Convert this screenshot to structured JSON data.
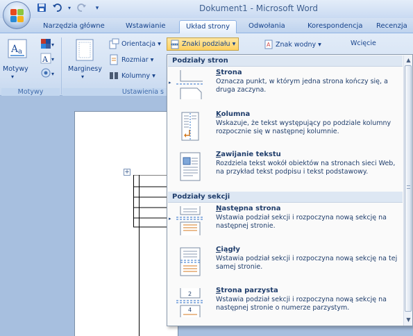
{
  "window": {
    "title": "Dokument1 - Microsoft Word"
  },
  "quick_access": {
    "icons": [
      "save-icon",
      "undo-icon",
      "redo-icon",
      "customize-icon"
    ]
  },
  "tabs": [
    {
      "label": "Narzędzia główne"
    },
    {
      "label": "Wstawianie"
    },
    {
      "label": "Układ strony",
      "active": true
    },
    {
      "label": "Odwołania"
    },
    {
      "label": "Korespondencja"
    },
    {
      "label": "Recenzja"
    }
  ],
  "ribbon": {
    "groups": {
      "themes": "Motywy",
      "page_setup": "Ustawienia s"
    },
    "themes_button": "Motywy",
    "margins_button": "Marginesy",
    "orientation": "Orientacja",
    "size": "Rozmiar",
    "columns": "Kolumny",
    "breaks": "Znaki podziału",
    "watermark": "Znak wodny",
    "indent": "Wcięcie"
  },
  "menu": {
    "section1": "Podziały stron",
    "section2": "Podziały sekcji",
    "items": [
      {
        "title_u": "S",
        "title_rest": "trona",
        "desc": "Oznacza punkt, w którym jedna strona kończy się, a druga zaczyna."
      },
      {
        "title_u": "K",
        "title_rest": "olumna",
        "desc": "Wskazuje, że tekst występujący po podziale kolumny rozpocznie się w następnej kolumnie."
      },
      {
        "title_u": "Z",
        "title_rest": "awijanie tekstu",
        "desc": "Rozdziela tekst wokół obiektów na stronach sieci Web, na przykład tekst podpisu i tekst podstawowy."
      },
      {
        "title_u": "N",
        "title_rest": "astępna strona",
        "desc": "Wstawia podział sekcji i rozpoczyna nową sekcję na następnej stronie."
      },
      {
        "title_u": "C",
        "title_rest": "iągły",
        "desc": "Wstawia podział sekcji i rozpoczyna nową sekcję na tej samej stronie."
      },
      {
        "title_u": "S",
        "title_rest": "trona parzysta",
        "desc": "Wstawia podział sekcji i rozpoczyna nową sekcję na następnej stronie o numerze parzystym."
      }
    ],
    "even_page_numbers": [
      "2",
      "4"
    ]
  }
}
